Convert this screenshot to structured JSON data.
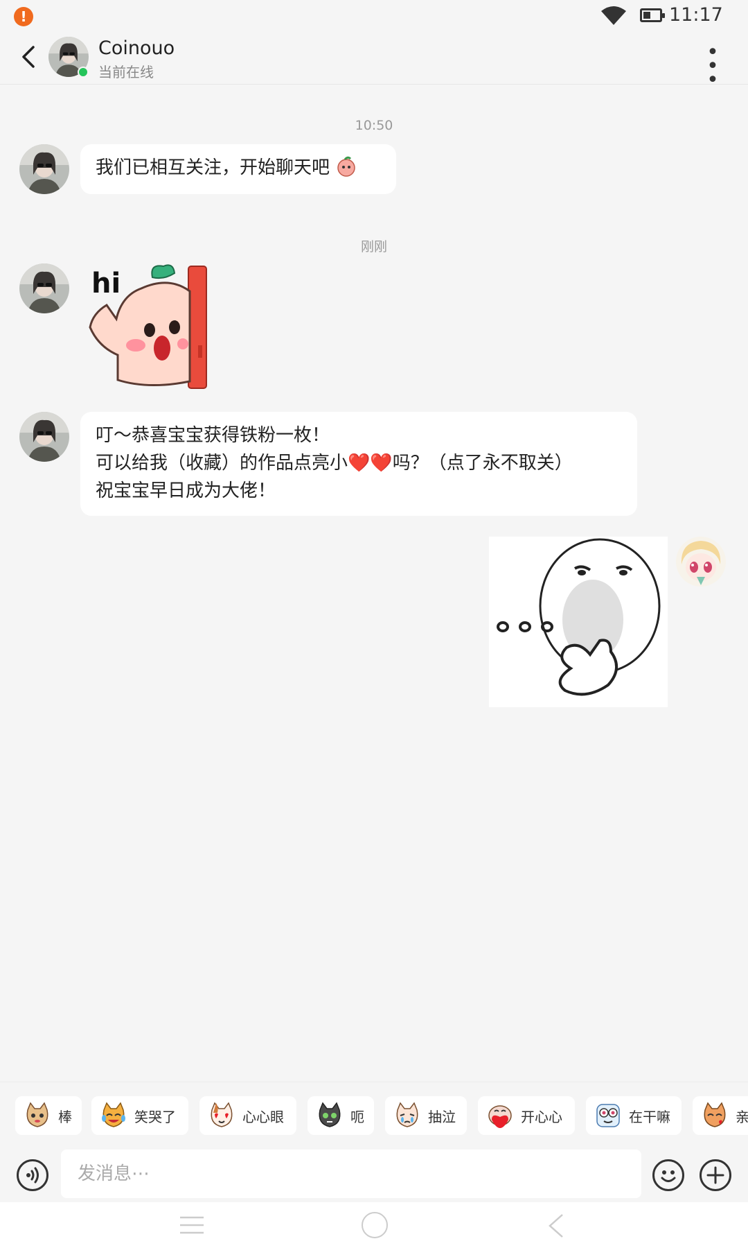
{
  "status_bar": {
    "alert_icon": "exclamation-icon",
    "wifi_icon": "wifi-icon",
    "battery_icon": "battery-icon",
    "time": "11:17"
  },
  "header": {
    "back_icon": "chevron-left-icon",
    "contact_name": "Coinouo",
    "contact_status": "当前在线",
    "more_icon": "more-dots-icon"
  },
  "messages": [
    {
      "type": "timestamp",
      "text": "10:50"
    },
    {
      "type": "text",
      "from": "them",
      "text": "我们已相互关注，开始聊天吧"
    },
    {
      "type": "timestamp",
      "text": "刚刚"
    },
    {
      "type": "sticker",
      "from": "them",
      "caption": "hi"
    },
    {
      "type": "text",
      "from": "them",
      "lines": [
        "叮～恭喜宝宝获得铁粉一枚！",
        "可以给我（收藏）的作品点亮小❤️❤️吗？（点了永不取关）",
        "祝宝宝早日成为大佬！"
      ]
    },
    {
      "type": "sticker",
      "from": "me",
      "caption": ""
    }
  ],
  "quick_emojis": [
    {
      "icon": "cat-face-icon",
      "label": "棒"
    },
    {
      "icon": "laughing-cry-icon",
      "label": "笑哭了"
    },
    {
      "icon": "heart-eyes-icon",
      "label": "心心眼"
    },
    {
      "icon": "speechless-cat-icon",
      "label": "呃"
    },
    {
      "icon": "sobbing-icon",
      "label": "抽泣"
    },
    {
      "icon": "happy-heart-icon",
      "label": "开心心"
    },
    {
      "icon": "peeking-icon",
      "label": "在干嘛"
    },
    {
      "icon": "kiss-icon",
      "label": "亲"
    }
  ],
  "input": {
    "placeholder": "发消息⋯",
    "value": "",
    "voice_icon": "voice-icon",
    "emoji_icon": "smiley-icon",
    "plus_icon": "plus-icon"
  },
  "nav_bar": {
    "menu_icon": "menu-lines-icon",
    "home_icon": "home-circle-icon",
    "back_icon": "back-triangle-icon"
  },
  "colors": {
    "background": "#f5f5f5",
    "bubble": "#ffffff",
    "online": "#25c45a",
    "alert": "#f06a1e",
    "heart": "#e8202a"
  }
}
